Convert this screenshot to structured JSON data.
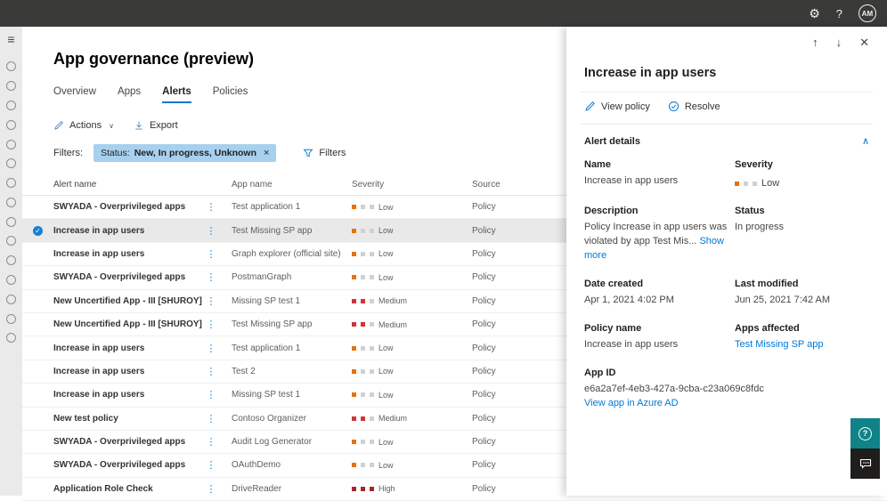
{
  "colors": {
    "accent": "#0078d4",
    "severity_low": "#e8710a",
    "severity_medium": "#d13438",
    "severity_high": "#a4262c",
    "severity_empty": "#d2d0ce"
  },
  "topbar": {
    "gear_icon": "⚙",
    "help_label": "?",
    "avatar_initials": "AM"
  },
  "sidebar": {
    "hamburger_icon": "≡",
    "placeholder_circle_count": 15
  },
  "page_title": "App governance (preview)",
  "tabs": [
    {
      "label": "Overview",
      "active": false
    },
    {
      "label": "Apps",
      "active": false
    },
    {
      "label": "Alerts",
      "active": true
    },
    {
      "label": "Policies",
      "active": false
    }
  ],
  "toolbar": {
    "actions_label": "Actions",
    "export_label": "Export"
  },
  "filter_bar": {
    "label": "Filters:",
    "chip": {
      "prefix": "Status:",
      "value": "New, In progress, Unknown",
      "dismiss_icon": "×"
    },
    "filters_button_label": "Filters"
  },
  "table": {
    "columns": [
      "Alert name",
      "App name",
      "Severity",
      "Source"
    ],
    "rows": [
      {
        "alert_name": "SWYADA - Overprivileged apps",
        "app_name": "Test application 1",
        "severity": "Low",
        "source": "Policy",
        "selected": false
      },
      {
        "alert_name": "Increase in app users",
        "app_name": "Test Missing SP app",
        "severity": "Low",
        "source": "Policy",
        "selected": true
      },
      {
        "alert_name": "Increase in app users",
        "app_name": "Graph explorer (official site)",
        "severity": "Low",
        "source": "Policy",
        "selected": false
      },
      {
        "alert_name": "SWYADA - Overprivileged apps",
        "app_name": "PostmanGraph",
        "severity": "Low",
        "source": "Policy",
        "selected": false
      },
      {
        "alert_name": "New Uncertified App - III [SHUROY]",
        "app_name": "Missing SP test 1",
        "severity": "Medium",
        "source": "Policy",
        "selected": false
      },
      {
        "alert_name": "New Uncertified App - III [SHUROY]",
        "app_name": "Test Missing SP app",
        "severity": "Medium",
        "source": "Policy",
        "selected": false
      },
      {
        "alert_name": "Increase in app users",
        "app_name": "Test application 1",
        "severity": "Low",
        "source": "Policy",
        "selected": false
      },
      {
        "alert_name": "Increase in app users",
        "app_name": "Test 2",
        "severity": "Low",
        "source": "Policy",
        "selected": false
      },
      {
        "alert_name": "Increase in app users",
        "app_name": "Missing SP test 1",
        "severity": "Low",
        "source": "Policy",
        "selected": false
      },
      {
        "alert_name": "New test policy",
        "app_name": "Contoso Organizer",
        "severity": "Medium",
        "source": "Policy",
        "selected": false
      },
      {
        "alert_name": "SWYADA - Overprivileged apps",
        "app_name": "Audit Log Generator",
        "severity": "Low",
        "source": "Policy",
        "selected": false
      },
      {
        "alert_name": "SWYADA - Overprivileged apps",
        "app_name": "OAuthDemo",
        "severity": "Low",
        "source": "Policy",
        "selected": false
      },
      {
        "alert_name": "Application Role Check",
        "app_name": "DriveReader",
        "severity": "High",
        "source": "Policy",
        "selected": false
      }
    ]
  },
  "panel": {
    "nav": {
      "up_icon": "↑",
      "down_icon": "↓",
      "close_icon": "✕"
    },
    "title": "Increase in app users",
    "commands": [
      {
        "label": "View policy"
      },
      {
        "label": "Resolve"
      }
    ],
    "section_title": "Alert details",
    "collapse_icon": "∧",
    "fields": {
      "name_label": "Name",
      "name_value": "Increase in app users",
      "severity_label": "Severity",
      "severity_value": "Low",
      "description_label": "Description",
      "description_value": "Policy Increase in app users was violated by app Test Mis...",
      "show_more_label": "Show more",
      "status_label": "Status",
      "status_value": "In progress",
      "date_created_label": "Date created",
      "date_created_value": "Apr 1, 2021 4:02 PM",
      "last_modified_label": "Last modified",
      "last_modified_value": "Jun 25, 2021 7:42 AM",
      "policy_name_label": "Policy name",
      "policy_name_value": "Increase in app users",
      "apps_affected_label": "Apps affected",
      "apps_affected_value": "Test Missing SP app",
      "app_id_label": "App ID",
      "app_id_value": "e6a2a7ef-4eb3-427a-9cba-c23a069c8fdc",
      "azure_link_label": "View app in Azure AD"
    }
  }
}
